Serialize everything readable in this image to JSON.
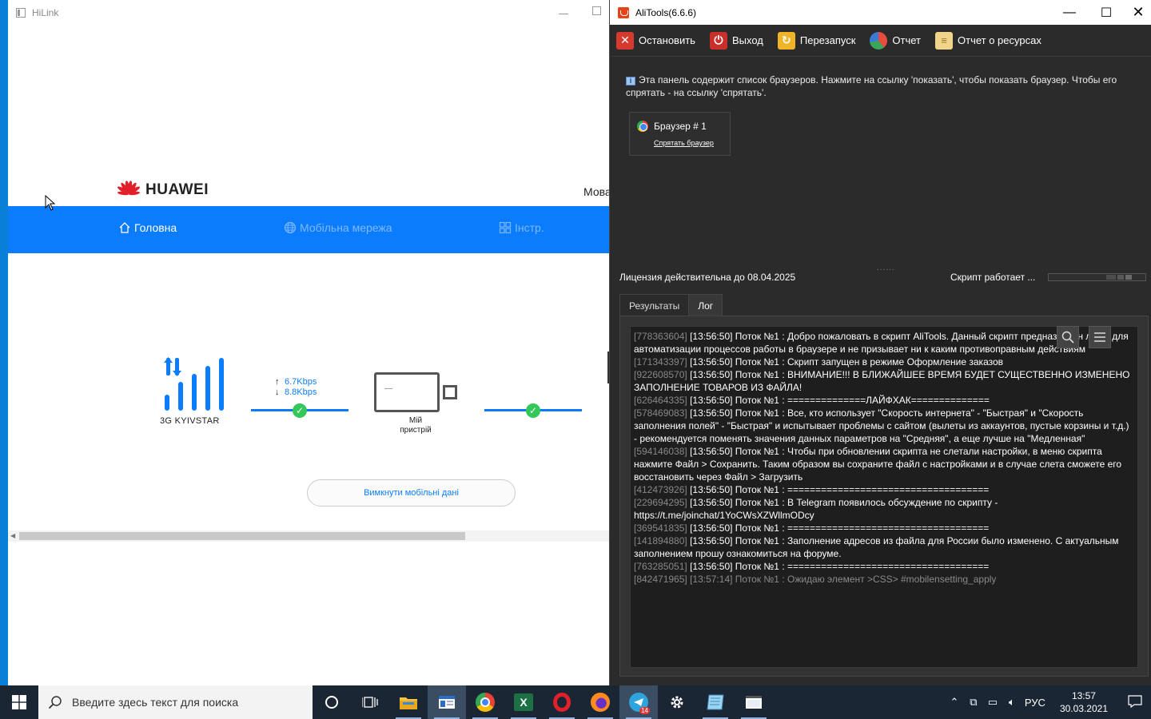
{
  "hilink": {
    "window_title": "HiLink",
    "brand": "HUAWEI",
    "lang_partial": "Мова",
    "nav": [
      {
        "label": "Головна"
      },
      {
        "label": "Мобільна мережа"
      },
      {
        "label": "Інстр."
      }
    ],
    "signal_label": "3G  KYIVSTAR",
    "upload_speed": "6.7Kbps",
    "download_speed": "8.8Kbps",
    "device_label_1": "Мій",
    "device_label_2": "пристрій",
    "mobile_data_button": "Вимкнути мобільні дані"
  },
  "alitools": {
    "window_title": "AliTools(6.6.6)",
    "toolbar": [
      {
        "label": "Остановить"
      },
      {
        "label": "Выход"
      },
      {
        "label": "Перезапуск"
      },
      {
        "label": "Отчет"
      },
      {
        "label": "Отчет о ресурсах"
      }
    ],
    "info_text": "Эта панель содержит список браузеров. Нажмите на ссылку 'показать', чтобы показать браузер. Чтобы его спрятать - на ссылку 'спрятать'.",
    "browser_card": {
      "name": "Браузер # 1",
      "hide_link": "Спрятать браузер"
    },
    "splitter": "......",
    "license": "Лицензия действительна до 08.04.2025",
    "script_status": "Скрипт работает ...",
    "tabs": [
      {
        "label": "Результаты"
      },
      {
        "label": "Лог"
      }
    ],
    "log": [
      {
        "id": "[778363604]",
        "text": " [13:56:50] Поток №1 : Добро пожаловать в скрипт AliTools. Данный скрипт предназначен лишь для автоматизации процессов работы в браузере и не призывает ни к каким противоправным действиям"
      },
      {
        "id": "[171343397]",
        "text": " [13:56:50] Поток №1 : Скрипт запущен в режиме Оформление заказов"
      },
      {
        "id": "[922608570]",
        "text": " [13:56:50] Поток №1 : ВНИМАНИЕ!!! В БЛИЖАЙШЕЕ ВРЕМЯ БУДЕТ СУЩЕСТВЕННО ИЗМЕНЕНО ЗАПОЛНЕНИЕ ТОВАРОВ ИЗ ФАЙЛА!"
      },
      {
        "id": "[626464335]",
        "text": " [13:56:50] Поток №1 : ==============ЛАЙФХАК=============="
      },
      {
        "id": "[578469083]",
        "text": " [13:56:50] Поток №1 : Все, кто использует \"Скорость интернета\" - \"Быстрая\" и \"Скорость заполнения полей\" - \"Быстрая\" и испытывает проблемы с сайтом (вылеты из аккаунтов, пустые корзины и т.д.) - рекомендуется поменять значения данных параметров на \"Средняя\", а еще лучше на \"Медленная\""
      },
      {
        "id": "[594146038]",
        "text": " [13:56:50] Поток №1 : Чтобы при обновлении скрипта не слетали настройки, в меню скрипта нажмите Файл > Сохранить. Таким образом вы сохраните файл с настройками и в случае слета сможете его восстановить через Файл > Загрузить"
      },
      {
        "id": "[412473926]",
        "text": " [13:56:50] Поток №1 : ===================================="
      },
      {
        "id": "[229694295]",
        "text": " [13:56:50] Поток №1 : В Telegram появилось обсуждение по скрипту - https://t.me/joinchat/1YoCWsXZWllmODcy"
      },
      {
        "id": "[369541835]",
        "text": " [13:56:50] Поток №1 : ===================================="
      },
      {
        "id": "[141894880]",
        "text": " [13:56:50] Поток №1 : Заполнение адресов из файла для России было изменено. С актуальным заполнением прошу ознакомиться на форуме."
      },
      {
        "id": "[763285051]",
        "text": " [13:56:50] Поток №1 : ===================================="
      },
      {
        "id": "[842471965]",
        "text": " [13:57:14] Поток №1 : Ожидаю элемент >CSS> #mobilensetting_apply",
        "faded": true
      }
    ]
  },
  "taskbar": {
    "search_placeholder": "Введите здесь текст для поиска",
    "telegram_badge": "14",
    "language": "РУС",
    "time": "13:57",
    "date": "30.03.2021"
  },
  "icons": {
    "hilink_window": "window-icon",
    "start": "windows-logo-icon",
    "search": "search-icon",
    "cortana": "cortana-circle-icon",
    "task_view": "task-view-icon",
    "explorer": "folder-icon",
    "chrome": "chrome-icon",
    "excel": "excel-icon",
    "opera": "opera-icon",
    "firefox": "firefox-icon",
    "telegram": "telegram-icon",
    "settings": "gear-icon",
    "notification": "notification-icon"
  },
  "colors": {
    "hilink_blue": "#0b7dfc",
    "check_green": "#34c759",
    "alitools_bg": "#2b2b2b",
    "log_bg": "#1e1e1e",
    "taskbar_bg": "#1a2634",
    "desktop_blue": "#0a7fd8"
  }
}
